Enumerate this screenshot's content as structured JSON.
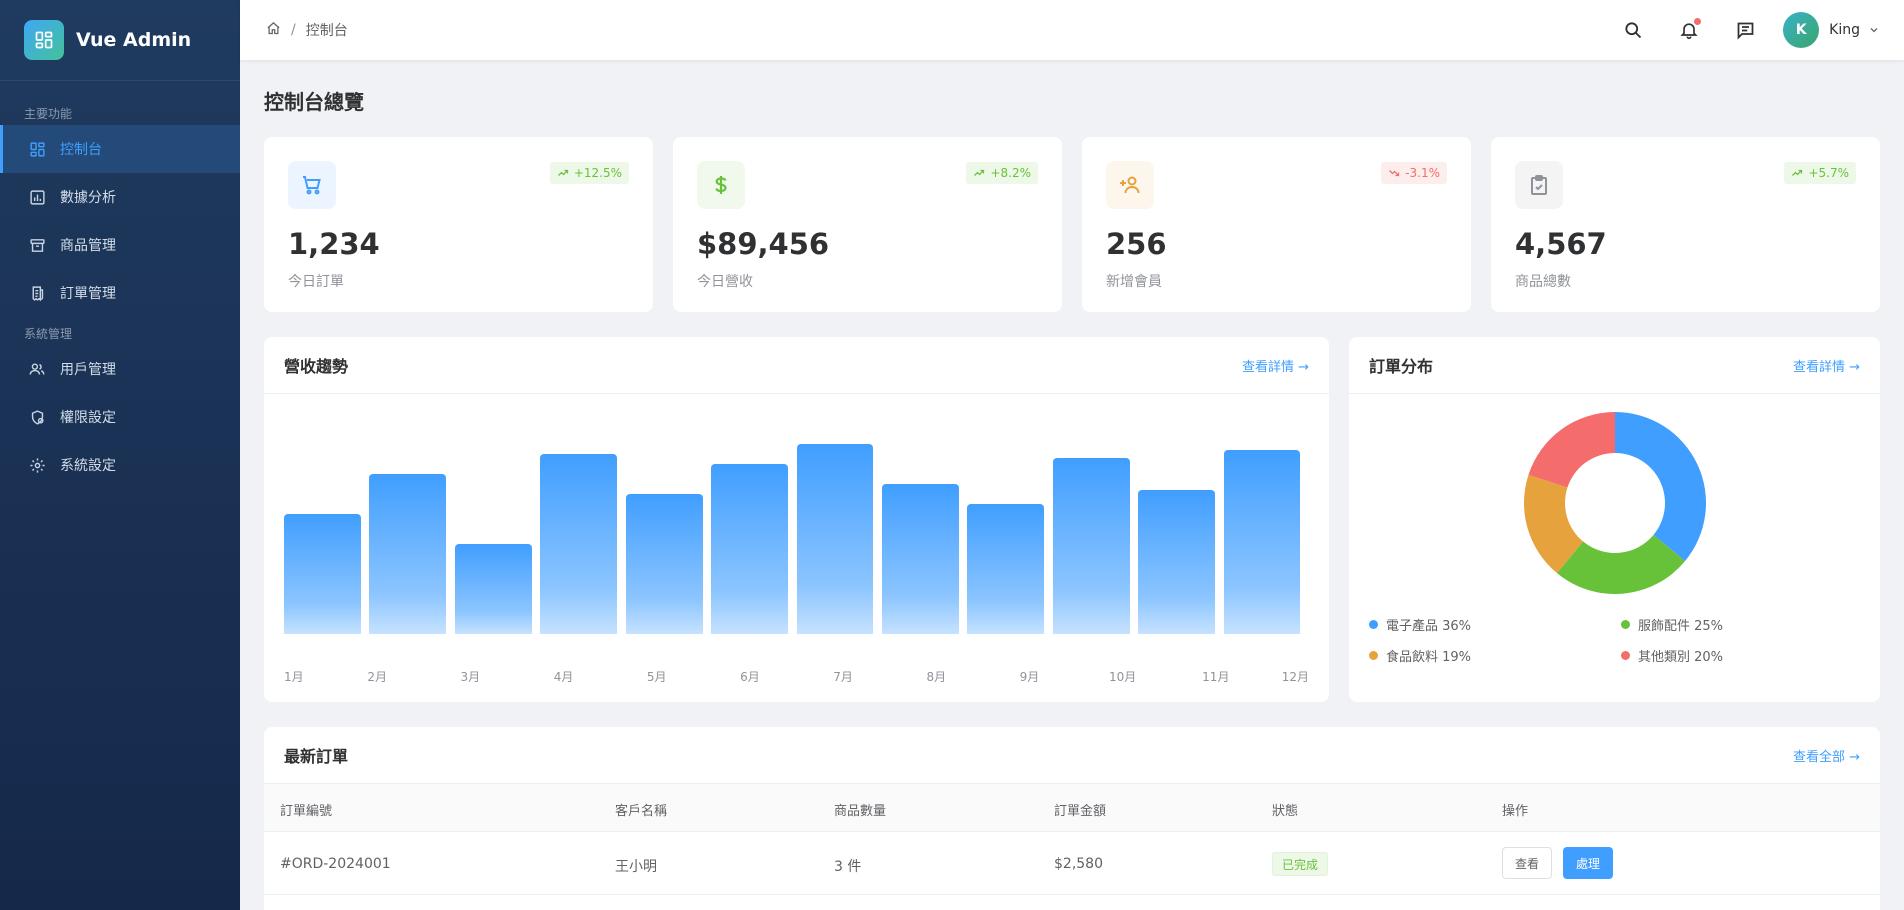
{
  "brand": {
    "title": "Vue Admin"
  },
  "sidebar": {
    "section_main": "主要功能",
    "section_system": "系統管理",
    "items": [
      {
        "label": "控制台",
        "icon": "dashboard-icon",
        "active": true
      },
      {
        "label": "數據分析",
        "icon": "chart-icon"
      },
      {
        "label": "商品管理",
        "icon": "box-icon"
      },
      {
        "label": "訂單管理",
        "icon": "receipt-icon"
      },
      {
        "label": "用戶管理",
        "icon": "users-icon"
      },
      {
        "label": "權限設定",
        "icon": "shield-lock-icon"
      },
      {
        "label": "系統設定",
        "icon": "gear-icon"
      }
    ]
  },
  "header": {
    "breadcrumb": {
      "separator": "/",
      "current": "控制台"
    },
    "user": {
      "initial": "K",
      "name": "King"
    },
    "notifications_unread": true
  },
  "page": {
    "title": "控制台總覽"
  },
  "stats": [
    {
      "value": "1,234",
      "label": "今日訂單",
      "trend": "+12.5%",
      "direction": "up",
      "icon": "cart-icon",
      "color": "#409eff"
    },
    {
      "value": "$89,456",
      "label": "今日營收",
      "trend": "+8.2%",
      "direction": "up",
      "icon": "dollar-icon",
      "color": "#67c23a"
    },
    {
      "value": "256",
      "label": "新增會員",
      "trend": "-3.1%",
      "direction": "down",
      "icon": "add-user-icon",
      "color": "#e6a23c"
    },
    {
      "value": "4,567",
      "label": "商品總數",
      "trend": "+5.7%",
      "direction": "up",
      "icon": "clipboard-check-icon",
      "color": "#909399"
    }
  ],
  "revenue": {
    "title": "營收趨勢",
    "link": "查看詳情 →",
    "chart_data": {
      "type": "bar",
      "categories": [
        "1月",
        "2月",
        "3月",
        "4月",
        "5月",
        "6月",
        "7月",
        "8月",
        "9月",
        "10月",
        "11月",
        "12月"
      ],
      "values": [
        60,
        80,
        45,
        90,
        70,
        85,
        95,
        75,
        65,
        88,
        72,
        92
      ],
      "ylim": [
        0,
        100
      ],
      "color": "#409eff"
    }
  },
  "distribution": {
    "title": "訂單分布",
    "link": "查看詳情 →",
    "chart_data": {
      "type": "pie",
      "categories": [
        "電子產品",
        "服飾配件",
        "食品飲料",
        "其他類別"
      ],
      "values": [
        36,
        25,
        19,
        20
      ],
      "colors": [
        "#409eff",
        "#67c23a",
        "#e6a23c",
        "#f56c6c"
      ],
      "labels": [
        "電子產品 36%",
        "服飾配件 25%",
        "食品飲料 19%",
        "其他類別 20%"
      ]
    }
  },
  "orders": {
    "title": "最新訂單",
    "link": "查看全部 →",
    "columns": [
      "訂單編號",
      "客戶名稱",
      "商品數量",
      "訂單金額",
      "狀態",
      "操作"
    ],
    "rows": [
      {
        "id": "#ORD-2024001",
        "customer": "王小明",
        "qty": "3 件",
        "amount": "$2,580",
        "status": "已完成",
        "view": "查看",
        "process": "處理"
      }
    ]
  }
}
